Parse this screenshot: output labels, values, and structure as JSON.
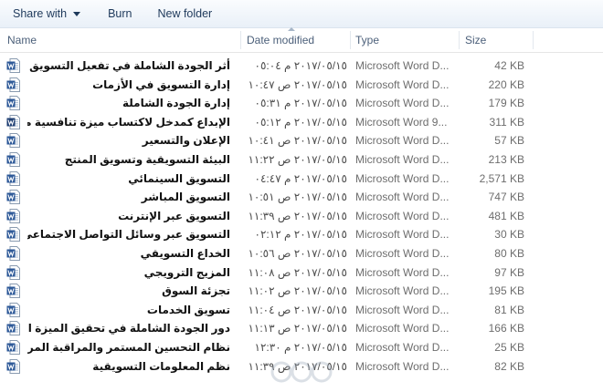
{
  "toolbar": {
    "share_with": "Share with",
    "burn": "Burn",
    "new_folder": "New folder"
  },
  "columns": {
    "name": "Name",
    "date_modified": "Date modified",
    "type": "Type",
    "size": "Size"
  },
  "files": [
    {
      "name": "أثر الجودة الشاملة في تفعيل التسويق",
      "date": "٢٠١٧/٠٥/١٥ م ٠٥:٠٤",
      "type": "Microsoft Word D...",
      "size": "42 KB",
      "icon": "word-docx-icon"
    },
    {
      "name": "إدارة التسويق في الأزمات",
      "date": "٢٠١٧/٠٥/١٥ ص ١٠:٤٧",
      "type": "Microsoft Word D...",
      "size": "220 KB",
      "icon": "word-docx-icon"
    },
    {
      "name": "إدارة الجودة الشاملة",
      "date": "٢٠١٧/٠٥/١٥ م ٠٥:٣١",
      "type": "Microsoft Word D...",
      "size": "179 KB",
      "icon": "word-docx-icon"
    },
    {
      "name": "الإبداع كمدخل لاكتساب ميزة تنافسية مستدامة ف...",
      "date": "٢٠١٧/٠٥/١٥ م ٠٥:١٢",
      "type": "Microsoft Word 9...",
      "size": "311 KB",
      "icon": "word-doc-icon"
    },
    {
      "name": "الإعلان والتسعير",
      "date": "٢٠١٧/٠٥/١٥ ص ١٠:٤١",
      "type": "Microsoft Word D...",
      "size": "57 KB",
      "icon": "word-docx-icon"
    },
    {
      "name": "البيئة التسويقية وتسويق المنتج",
      "date": "٢٠١٧/٠٥/١٥ ص ١١:٢٢",
      "type": "Microsoft Word D...",
      "size": "213 KB",
      "icon": "word-docx-icon"
    },
    {
      "name": "التسويق السينمائي",
      "date": "٢٠١٧/٠٥/١٥ م ٠٤:٤٧",
      "type": "Microsoft Word D...",
      "size": "2,571 KB",
      "icon": "word-docx-icon"
    },
    {
      "name": "التسويق المباشر",
      "date": "٢٠١٧/٠٥/١٥ ص ١٠:٥١",
      "type": "Microsoft Word D...",
      "size": "747 KB",
      "icon": "word-docx-icon"
    },
    {
      "name": "التسويق عبر الإنترنت",
      "date": "٢٠١٧/٠٥/١٥ ص ١١:٣٩",
      "type": "Microsoft Word D...",
      "size": "481 KB",
      "icon": "word-docx-icon"
    },
    {
      "name": "التسويق عبر وسائل التواصل الاجتماعي",
      "date": "٢٠١٧/٠٥/١٥ م ٠٢:١٢",
      "type": "Microsoft Word D...",
      "size": "30 KB",
      "icon": "word-docx-icon"
    },
    {
      "name": "الخداع التسويقي",
      "date": "٢٠١٧/٠٥/١٥ ص ١٠:٥٦",
      "type": "Microsoft Word D...",
      "size": "80 KB",
      "icon": "word-docx-icon"
    },
    {
      "name": "المزيج الترويجي",
      "date": "٢٠١٧/٠٥/١٥ ص ١١:٠٨",
      "type": "Microsoft Word D...",
      "size": "97 KB",
      "icon": "word-docx-icon"
    },
    {
      "name": "تجزئة السوق",
      "date": "٢٠١٧/٠٥/١٥ ص ١١:٠٢",
      "type": "Microsoft Word D...",
      "size": "195 KB",
      "icon": "word-docx-icon"
    },
    {
      "name": "تسويق الخدمات",
      "date": "٢٠١٧/٠٥/١٥ ص ١١:٠٤",
      "type": "Microsoft Word D...",
      "size": "81 KB",
      "icon": "word-docx-icon"
    },
    {
      "name": "دور الجودة الشاملة في تحقيق الميزة التنافسية",
      "date": "٢٠١٧/٠٥/١٥ ص ١١:١٣",
      "type": "Microsoft Word D...",
      "size": "166 KB",
      "icon": "word-docx-icon"
    },
    {
      "name": "نظام التحسين المستمر والمراقبة المركزة",
      "date": "٢٠١٧/٠٥/١٥ م ١٢:٣٠",
      "type": "Microsoft Word D...",
      "size": "25 KB",
      "icon": "word-docx-icon"
    },
    {
      "name": "نظم المعلومات التسويقية",
      "date": "٢٠١٧/٠٥/١٥ ص ١١:٣٩",
      "type": "Microsoft Word D...",
      "size": "82 KB",
      "icon": "word-docx-icon"
    }
  ],
  "colors": {
    "word_blue": "#2b5797",
    "header_text": "#4c607a",
    "toolbar_text": "#1e395b"
  }
}
